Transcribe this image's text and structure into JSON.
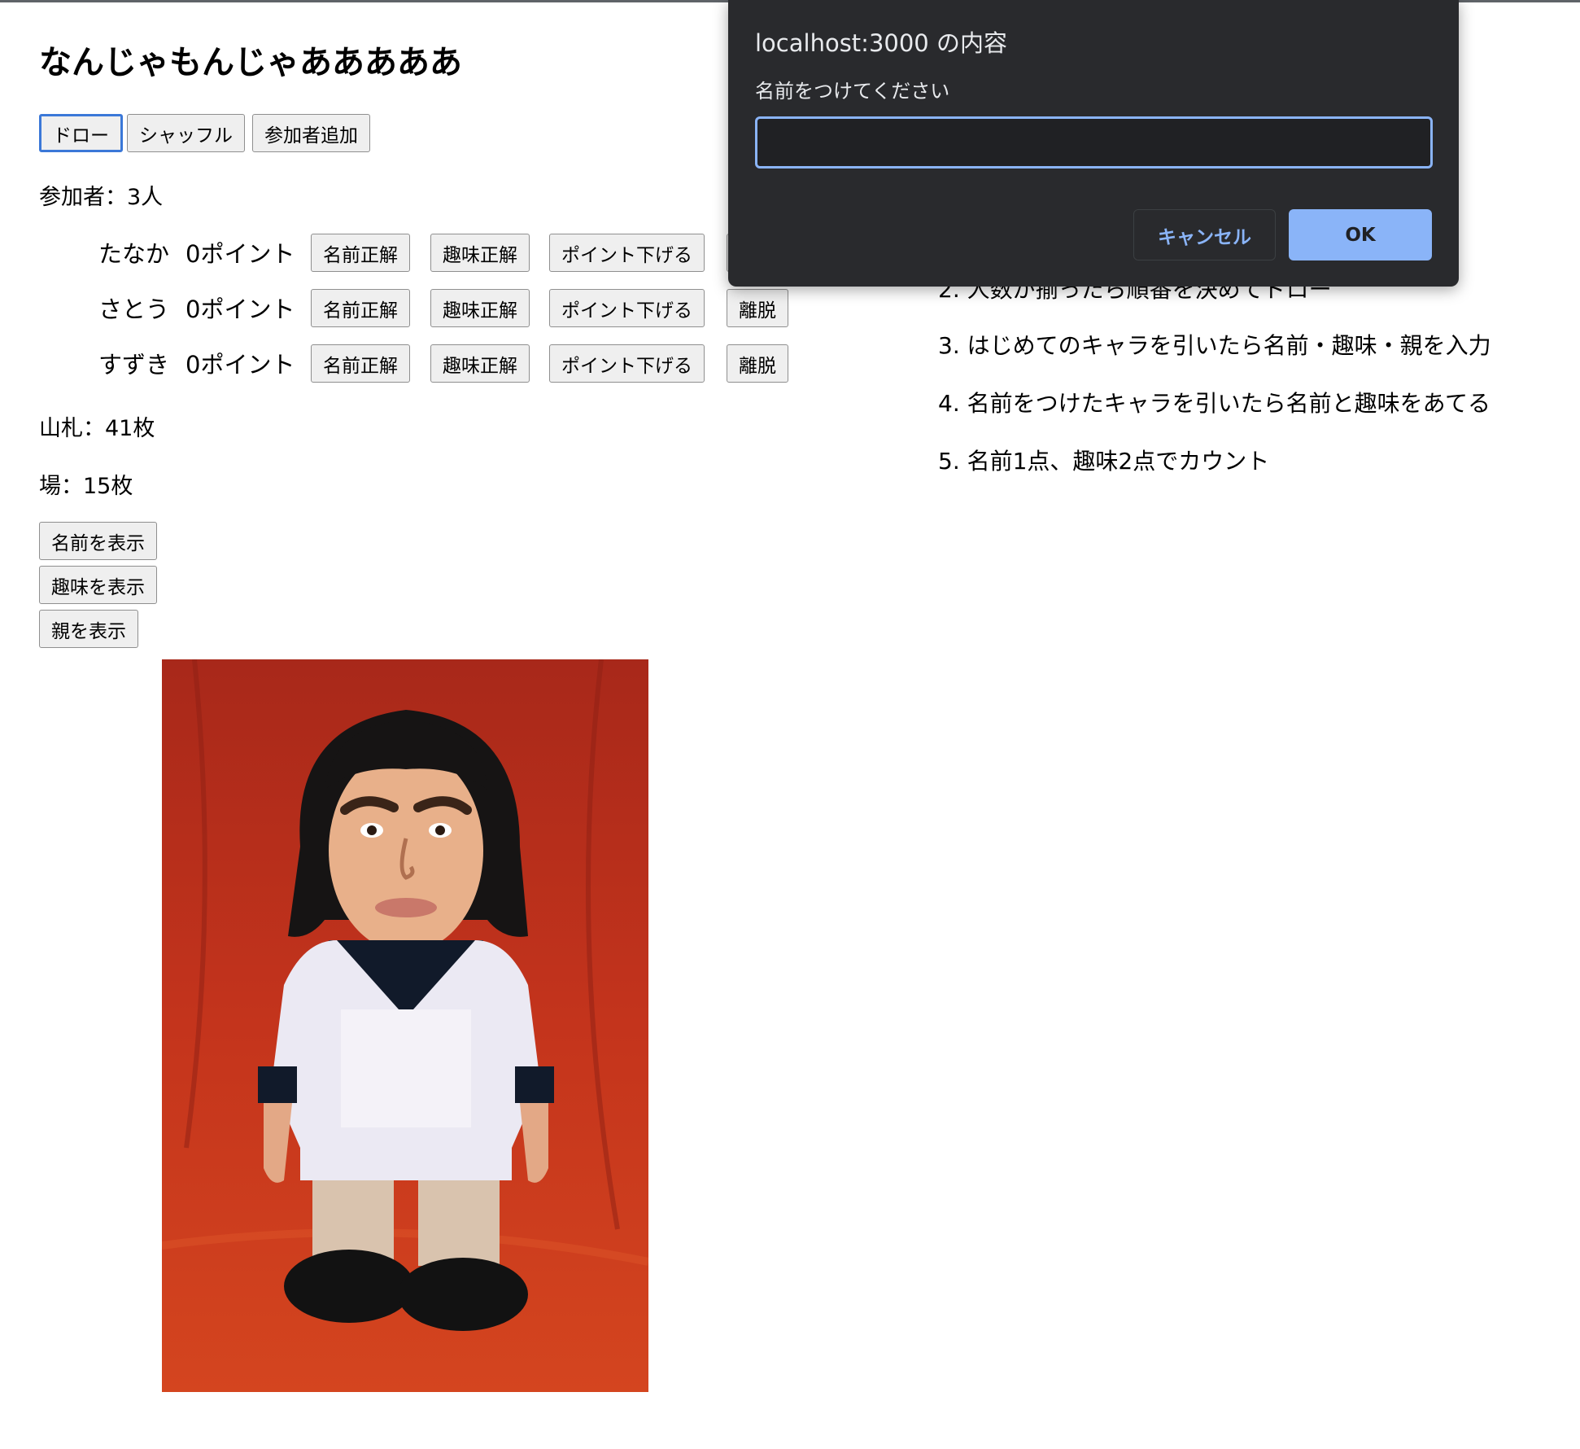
{
  "page": {
    "title": "なんじゃもんじゃあああああ"
  },
  "toolbar": {
    "draw_label": "ドロー",
    "shuffle_label": "シャッフル",
    "add_label": "参加者追加"
  },
  "participants_count_text": "参加者：3人",
  "participants": [
    {
      "name": "たなか",
      "points": "0ポイント"
    },
    {
      "name": "さとう",
      "points": "0ポイント"
    },
    {
      "name": "すずき",
      "points": "0ポイント"
    }
  ],
  "participant_buttons": {
    "name_correct": "名前正解",
    "hobby_correct": "趣味正解",
    "point_down": "ポイント下げる",
    "leave": "離脱"
  },
  "deck_text": "山札：41枚",
  "field_text": "場：15枚",
  "show_buttons": {
    "name": "名前を表示",
    "hobby": "趣味を表示",
    "parent": "親を表示"
  },
  "rules": {
    "partial": "2. 人数が揃ったら順番を決めてドロー",
    "items": [
      "3. はじめてのキャラを引いたら名前・趣味・親を入力",
      "4. 名前をつけたキャラを引いたら名前と趣味をあてる",
      "5. 名前1点、趣味2点でカウント"
    ]
  },
  "dialog": {
    "title": "localhost:3000 の内容",
    "message": "名前をつけてください",
    "input_value": "",
    "cancel_label": "キャンセル",
    "ok_label": "OK"
  },
  "colors": {
    "dialog_bg": "#292a2d",
    "accent": "#8ab4f8",
    "card_bg": "#c0311a"
  }
}
